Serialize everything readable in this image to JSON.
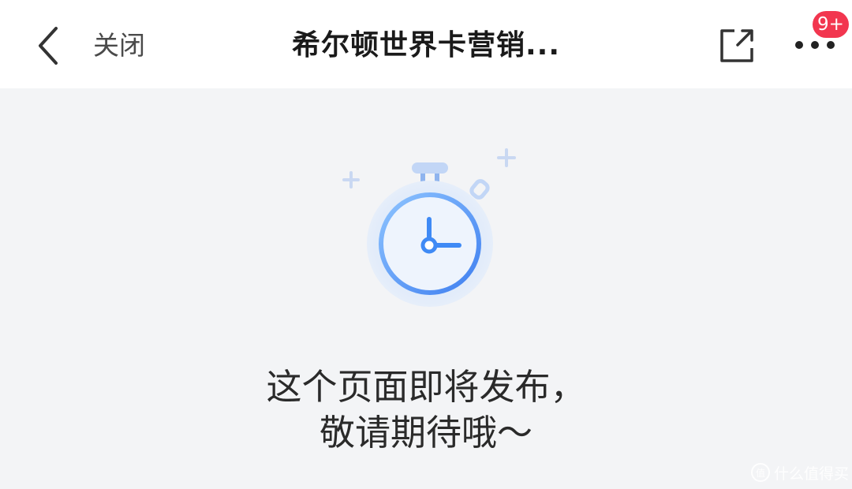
{
  "nav": {
    "close_label": "关闭",
    "title": "希尔顿世界卡营销...",
    "badge": "9+"
  },
  "icons": {
    "back": "chevron-left-icon",
    "share": "external-share-icon",
    "more": "more-dots-icon",
    "illustration": "stopwatch-icon"
  },
  "message": {
    "line1": "这个页面即将发布，",
    "line2": "敬请期待哦～"
  },
  "watermark": {
    "glyph": "值",
    "text": "什么值得买"
  },
  "colors": {
    "badge": "#f2364f",
    "background": "#f3f4f6",
    "accent": "#4a90f5"
  }
}
